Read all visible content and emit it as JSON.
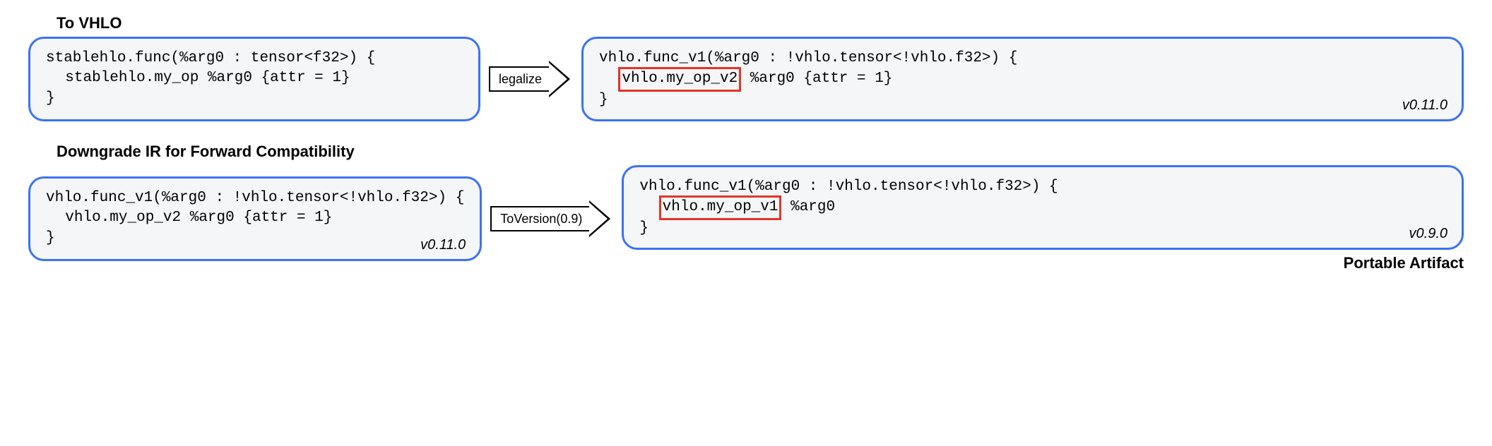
{
  "section1": {
    "title": "To VHLO",
    "left": {
      "line1a": "stablehlo.func(%arg0 : tensor<f32>) {",
      "line2a": "stablehlo.my_op %arg0 {attr = 1}",
      "line3a": "}"
    },
    "arrow_label": "legalize",
    "right": {
      "line1a": "vhlo.func_v1(%arg0 : !vhlo.tensor<!vhlo.f32>) {",
      "hl2": "vhlo.my_op_v2",
      "rest2": " %arg0 {attr = 1}",
      "line3a": "}",
      "version": "v0.11.0"
    }
  },
  "section2": {
    "title": "Downgrade IR for Forward Compatibility",
    "left": {
      "line1a": "vhlo.func_v1(%arg0 : !vhlo.tensor<!vhlo.f32>) {",
      "line2a": "vhlo.my_op_v2 %arg0 {attr = 1}",
      "line3a": "}",
      "version": "v0.11.0"
    },
    "arrow_label": "ToVersion(0.9)",
    "right": {
      "line1a": "vhlo.func_v1(%arg0 : !vhlo.tensor<!vhlo.f32>) {",
      "hl2": "vhlo.my_op_v1",
      "rest2": " %arg0",
      "line3a": "}",
      "version": "v0.9.0"
    },
    "footer": "Portable Artifact"
  }
}
